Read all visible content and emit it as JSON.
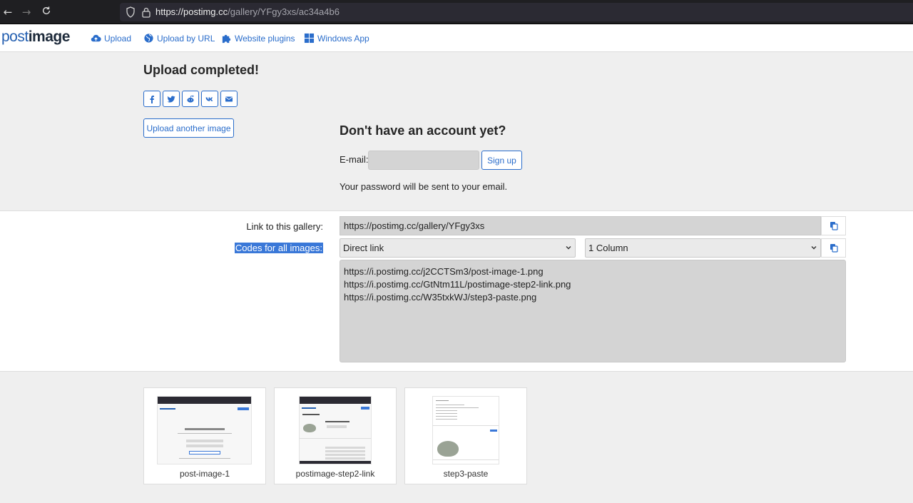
{
  "browser": {
    "url_host": "https://postimg.cc",
    "url_path": "/gallery/YFgy3xs/ac34a4b6"
  },
  "topnav": {
    "logo_post": "post",
    "logo_image": "image",
    "links": [
      {
        "label": "Upload",
        "icon": "cloud-upload-icon"
      },
      {
        "label": "Upload by URL",
        "icon": "globe-icon"
      },
      {
        "label": "Website plugins",
        "icon": "puzzle-icon"
      },
      {
        "label": "Windows App",
        "icon": "windows-icon"
      }
    ]
  },
  "upload": {
    "title": "Upload completed!",
    "share_buttons": [
      "facebook-icon",
      "twitter-icon",
      "reddit-icon",
      "vk-icon",
      "envelope-icon"
    ],
    "upload_another_label": "Upload another image"
  },
  "account": {
    "title": "Don't have an account yet?",
    "email_label": "E-mail:",
    "email_value": "",
    "signup_label": "Sign up",
    "password_note": "Your password will be sent to your email."
  },
  "links": {
    "gallery_label": "Link to this gallery:",
    "gallery_url": "https://postimg.cc/gallery/YFgy3xs",
    "codes_label": "Codes for all images:",
    "format_selected": "Direct link",
    "columns_selected": "1 Column",
    "codes": [
      "https://i.postimg.cc/j2CCTSm3/post-image-1.png",
      "https://i.postimg.cc/GtNtm11L/postimage-step2-link.png",
      "https://i.postimg.cc/W35txkWJ/step3-paste.png"
    ]
  },
  "thumbnails": [
    {
      "label": "post-image-1"
    },
    {
      "label": "postimage-step2-link"
    },
    {
      "label": "step3-paste"
    }
  ],
  "colors": {
    "accent": "#2a6dcb",
    "selection": "#3a78d8",
    "field_grey": "#d4d4d4"
  }
}
